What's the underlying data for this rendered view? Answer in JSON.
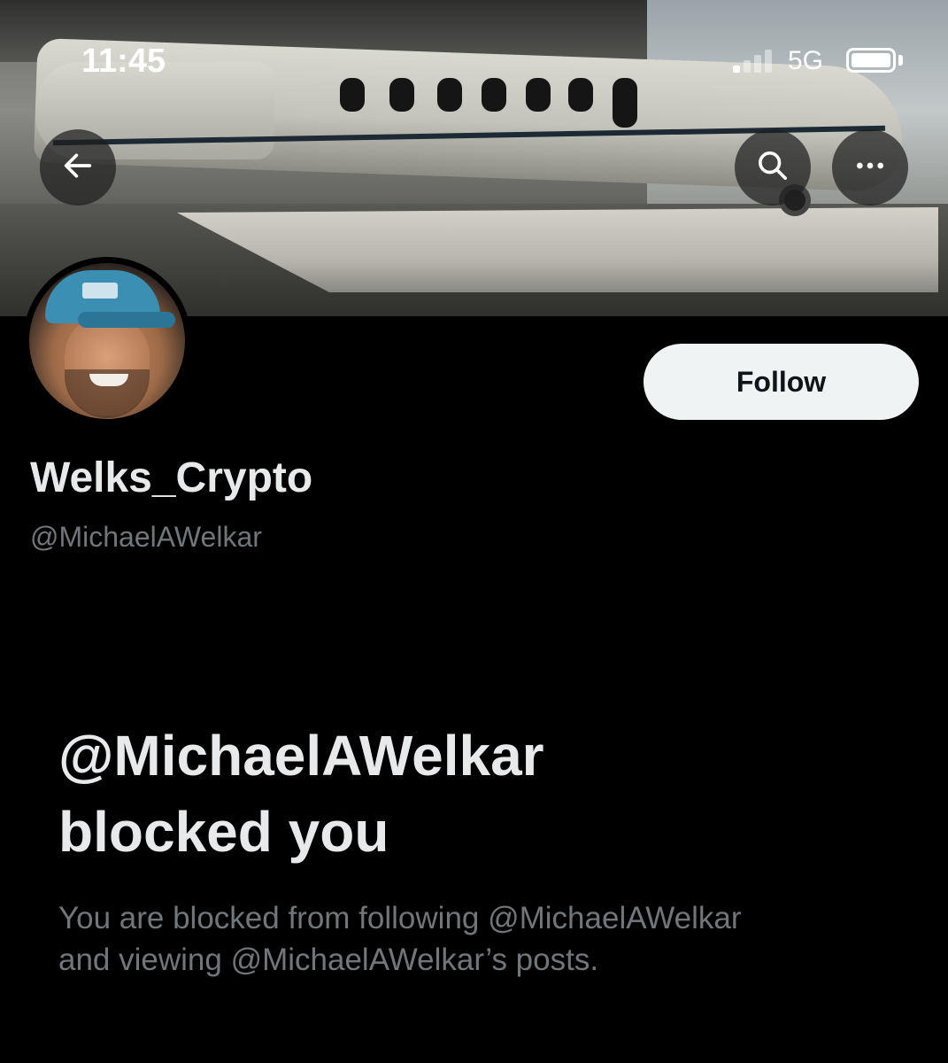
{
  "status_bar": {
    "time": "11:45",
    "network": "5G"
  },
  "banner": {
    "back_icon": "arrow-left-icon",
    "search_icon": "search-icon",
    "more_icon": "more-horizontal-icon"
  },
  "profile": {
    "follow_label": "Follow",
    "display_name": "Welks_Crypto",
    "handle": "@MichaelAWelkar"
  },
  "blocked": {
    "title_line1": "@MichaelAWelkar",
    "title_line2": "blocked you",
    "desc_line1": "You are blocked from following @MichaelAWelkar",
    "desc_line2": "and viewing @MichaelAWelkar’s posts."
  },
  "colors": {
    "background": "#000000",
    "primary_text": "#e7e9ea",
    "secondary_text": "#71767b",
    "follow_bg": "#eff3f4"
  }
}
